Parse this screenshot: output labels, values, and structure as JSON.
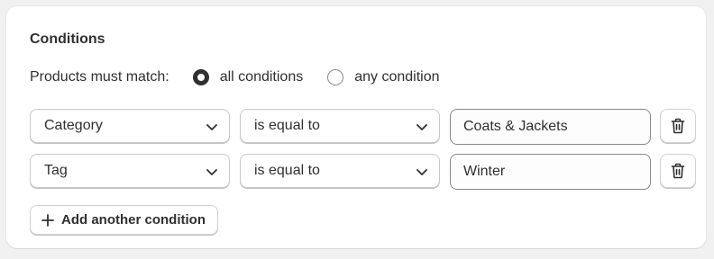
{
  "section": {
    "title": "Conditions",
    "match_label": "Products must match:",
    "match_options": [
      {
        "label": "all conditions",
        "selected": true
      },
      {
        "label": "any condition",
        "selected": false
      }
    ]
  },
  "conditions": [
    {
      "field": "Category",
      "operator": "is equal to",
      "value": "Coats & Jackets"
    },
    {
      "field": "Tag",
      "operator": "is equal to",
      "value": "Winter"
    }
  ],
  "add_button": {
    "label": "Add another condition",
    "icon": "plus-icon"
  },
  "icons": {
    "select": "chevron-down-icon",
    "delete": "trash-icon"
  },
  "colors": {
    "text": "#303030",
    "border": "#8a8a8a",
    "background": "#f1f1f1"
  }
}
